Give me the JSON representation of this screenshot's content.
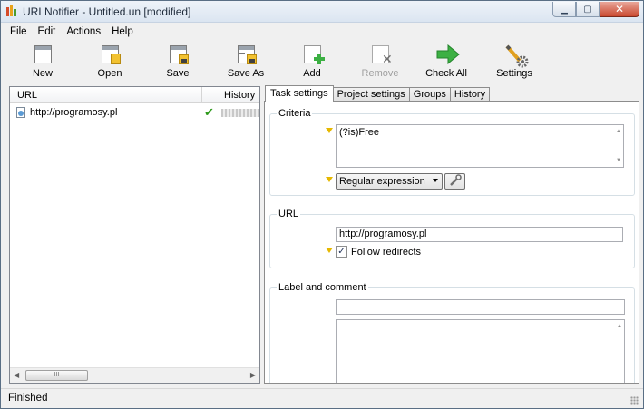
{
  "window": {
    "title": "URLNotifier - Untitled.un [modified]"
  },
  "menu": [
    "File",
    "Edit",
    "Actions",
    "Help"
  ],
  "toolbar": {
    "new": "New",
    "open": "Open",
    "save": "Save",
    "save_as": "Save As",
    "add": "Add",
    "remove": "Remove",
    "check_all": "Check All",
    "settings": "Settings"
  },
  "left_panel": {
    "columns": {
      "url": "URL",
      "history": "History"
    },
    "rows": [
      {
        "url": "http://programosy.pl",
        "status": "ok"
      }
    ],
    "hscroll_thumb": "III"
  },
  "tabs": [
    "Task settings",
    "Project settings",
    "Groups",
    "History"
  ],
  "task_settings": {
    "criteria": {
      "title": "Criteria",
      "pattern": "(?is)Free",
      "match_type": "Regular expression"
    },
    "url": {
      "title": "URL",
      "value": "http://programosy.pl",
      "follow_redirects_label": "Follow redirects",
      "follow_redirects": true
    },
    "label_comment": {
      "title": "Label and comment",
      "label": "",
      "comment": ""
    }
  },
  "status": {
    "text": "Finished"
  },
  "colors": {
    "accent_arrow": "#3cb043",
    "marker": "#e6b800",
    "check": "#2e9a1c",
    "close_button": "#c9482f"
  }
}
